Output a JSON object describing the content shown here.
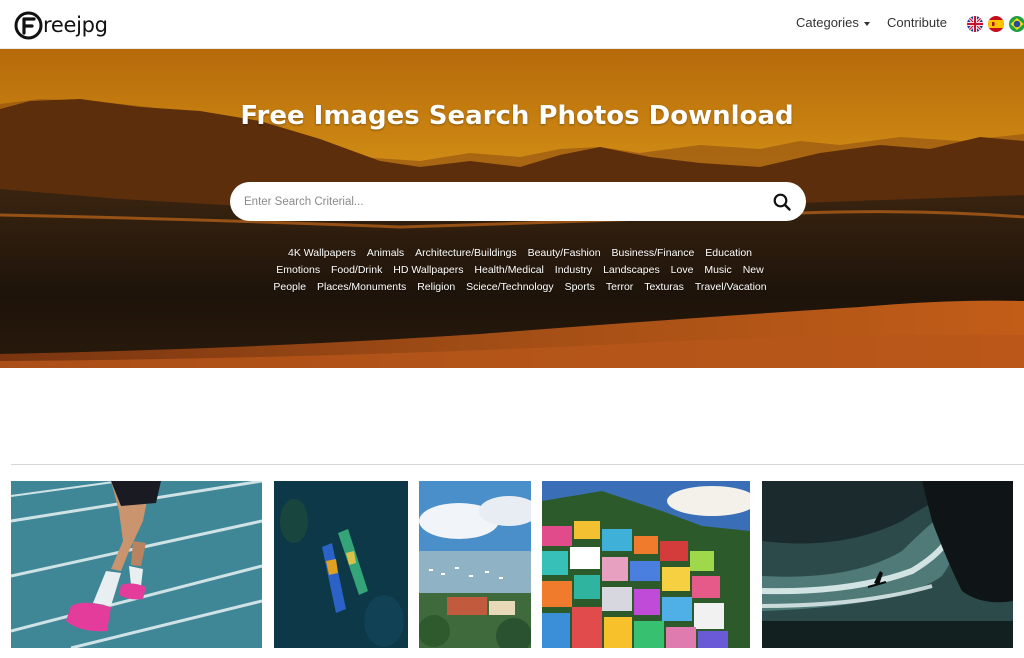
{
  "header": {
    "logo_text": "reejpg",
    "nav": {
      "categories": "Categories",
      "contribute": "Contribute"
    },
    "languages": [
      "English",
      "Español",
      "Português"
    ]
  },
  "hero": {
    "title": "Free Images Search Photos Download",
    "search_placeholder": "Enter Search Criterial...",
    "categories": [
      "4K Wallpapers",
      "Animals",
      "Architecture/Buildings",
      "Beauty/Fashion",
      "Business/Finance",
      "Education",
      "Emotions",
      "Food/Drink",
      "HD Wallpapers",
      "Health/Medical",
      "Industry",
      "Landscapes",
      "Love",
      "Music",
      "New",
      "People",
      "Places/Monuments",
      "Religion",
      "Sciece/Technology",
      "Sports",
      "Terror",
      "Texturas",
      "Travel/Vacation"
    ]
  },
  "gallery": {
    "items": [
      {
        "subject": "runner-on-track"
      },
      {
        "subject": "kayaks-aerial"
      },
      {
        "subject": "harbor-city"
      },
      {
        "subject": "colorful-hillside-houses"
      },
      {
        "subject": "surfer-big-wave"
      }
    ]
  },
  "colors": {
    "accent": "#c8860a",
    "hero_dark": "#2a1a08",
    "text": "#333333"
  }
}
